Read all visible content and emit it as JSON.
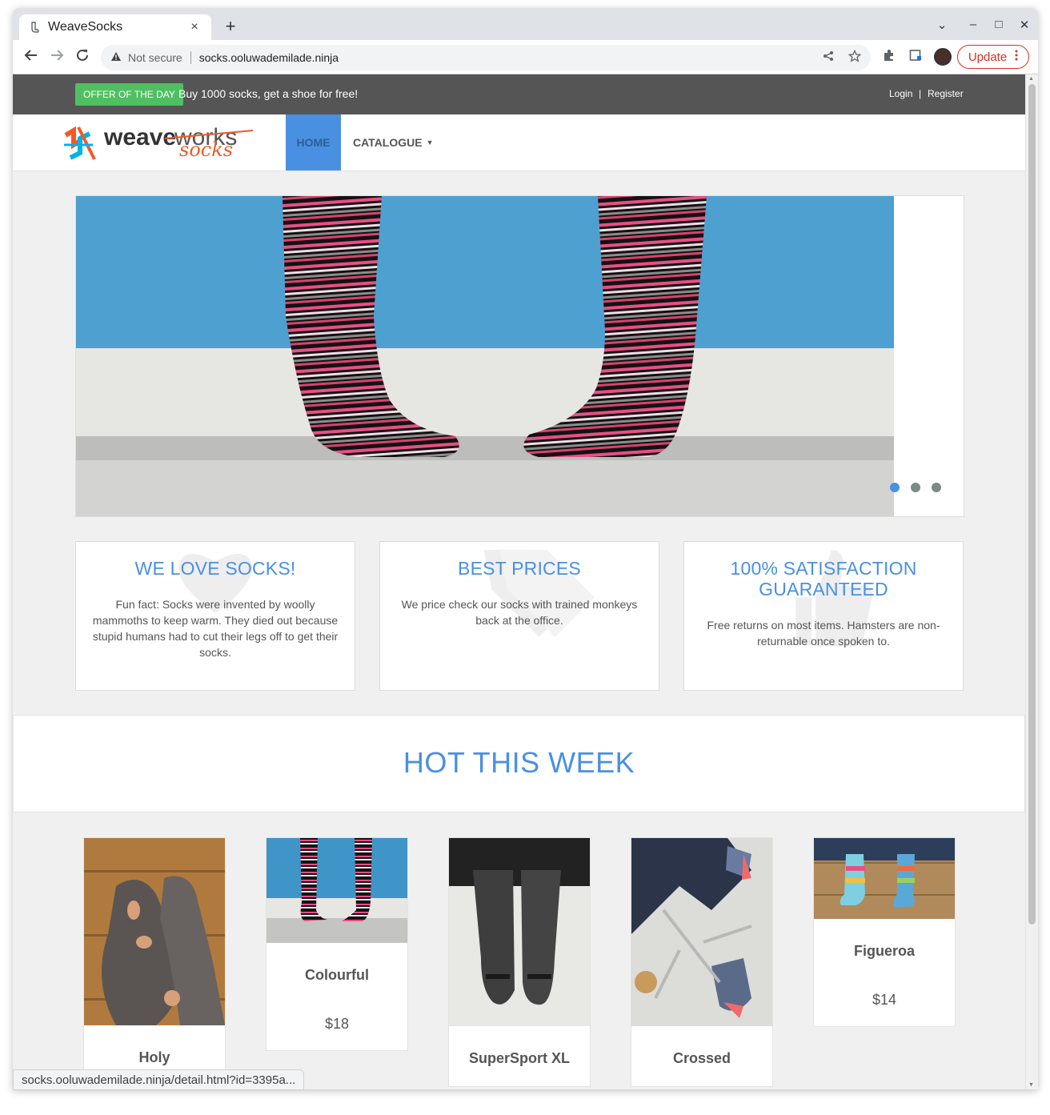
{
  "browser": {
    "tab_title": "WeaveSocks",
    "tab_favicon": "page-icon",
    "new_tab": "+",
    "close_tab": "×",
    "window_controls": {
      "minimize": "–",
      "maximize": "□",
      "close": "✕",
      "tab_search": "⌄"
    },
    "security_label": "Not secure",
    "url": "socks.ooluwademilade.ninja",
    "update_label": "Update",
    "status_url": "socks.ooluwademilade.ninja/detail.html?id=3395a..."
  },
  "topbar": {
    "offer_badge": "OFFER OF THE DAY",
    "offer_text": "Buy 1000 socks, get a shoe for free!",
    "login": "Login",
    "separator": "|",
    "register": "Register"
  },
  "navbar": {
    "logo_word1": "weave",
    "logo_word2": "works",
    "logo_word3": "socks",
    "home": "HOME",
    "catalogue": "CATALOGUE"
  },
  "carousel": {
    "slides": 3,
    "active_slide": 1
  },
  "features": [
    {
      "title": "WE LOVE SOCKS!",
      "text": "Fun fact: Socks were invented by woolly mammoths to keep warm. They died out because stupid humans had to cut their legs off to get their socks.",
      "icon": "heart-icon"
    },
    {
      "title": "BEST PRICES",
      "text": "We price check our socks with trained monkeys back at the office.",
      "icon": "tags-icon"
    },
    {
      "title": "100% SATISFACTION GUARANTEED",
      "text": "Free returns on most items. Hamsters are non-returnable once spoken to.",
      "icon": "thumbs-up-icon"
    }
  ],
  "hot": {
    "title": "HOT THIS WEEK"
  },
  "products": [
    {
      "name": "Holy",
      "price": ""
    },
    {
      "name": "Colourful",
      "price": "$18"
    },
    {
      "name": "SuperSport XL",
      "price": ""
    },
    {
      "name": "Crossed",
      "price": ""
    },
    {
      "name": "Figueroa",
      "price": "$14"
    }
  ],
  "colors": {
    "accent": "#4a90e2",
    "offer_green": "#4fbf61",
    "topbar": "#555555",
    "update_red": "#d93025"
  }
}
